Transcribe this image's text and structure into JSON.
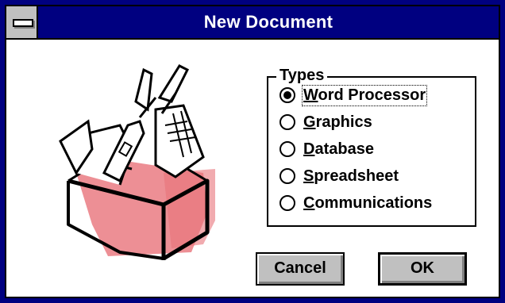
{
  "window": {
    "title": "New Document"
  },
  "types_group": {
    "label": "Types",
    "options": [
      {
        "label": "Word Processor",
        "mnemonic": "W",
        "rest": "ord Processor",
        "selected": true
      },
      {
        "label": "Graphics",
        "mnemonic": "G",
        "rest": "raphics",
        "selected": false
      },
      {
        "label": "Database",
        "mnemonic": "D",
        "rest": "atabase",
        "selected": false
      },
      {
        "label": "Spreadsheet",
        "mnemonic": "S",
        "rest": "preadsheet",
        "selected": false
      },
      {
        "label": "Communications",
        "mnemonic": "C",
        "rest": "ommunications",
        "selected": false
      }
    ]
  },
  "buttons": {
    "cancel": "Cancel",
    "ok": "OK"
  },
  "colors": {
    "titlebar": "#000080",
    "button_face": "#c0c0c0",
    "art_accent": "#e8737a"
  },
  "icons": {
    "system_menu": "system-menu-icon",
    "illustration": "document-box-illustration"
  }
}
